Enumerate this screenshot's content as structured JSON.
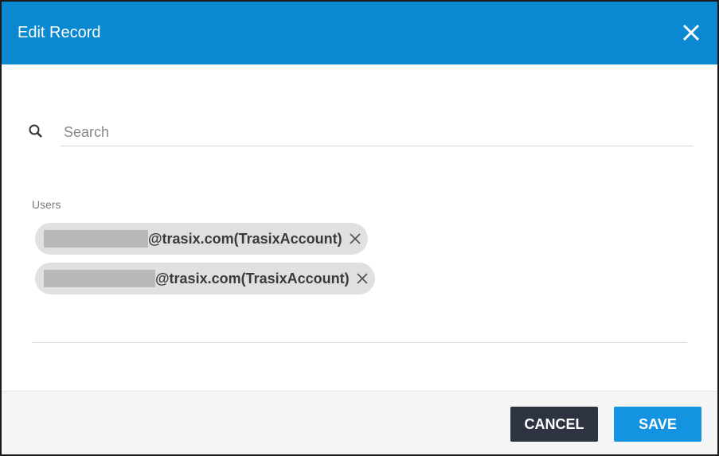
{
  "dialog": {
    "title": "Edit Record",
    "close_icon": "close-icon"
  },
  "search": {
    "icon": "search-icon",
    "placeholder": "Search",
    "value": ""
  },
  "users": {
    "label": "Users",
    "items": [
      {
        "email_suffix": "@trasix.com(TrasixAccount)",
        "name_redacted": true
      },
      {
        "email_suffix": "@trasix.com(TrasixAccount)",
        "name_redacted": true
      }
    ]
  },
  "footer": {
    "cancel_label": "CANCEL",
    "save_label": "SAVE"
  },
  "colors": {
    "header": "#0a88d2",
    "save_button": "#1493e0",
    "cancel_button": "#2d3340"
  }
}
